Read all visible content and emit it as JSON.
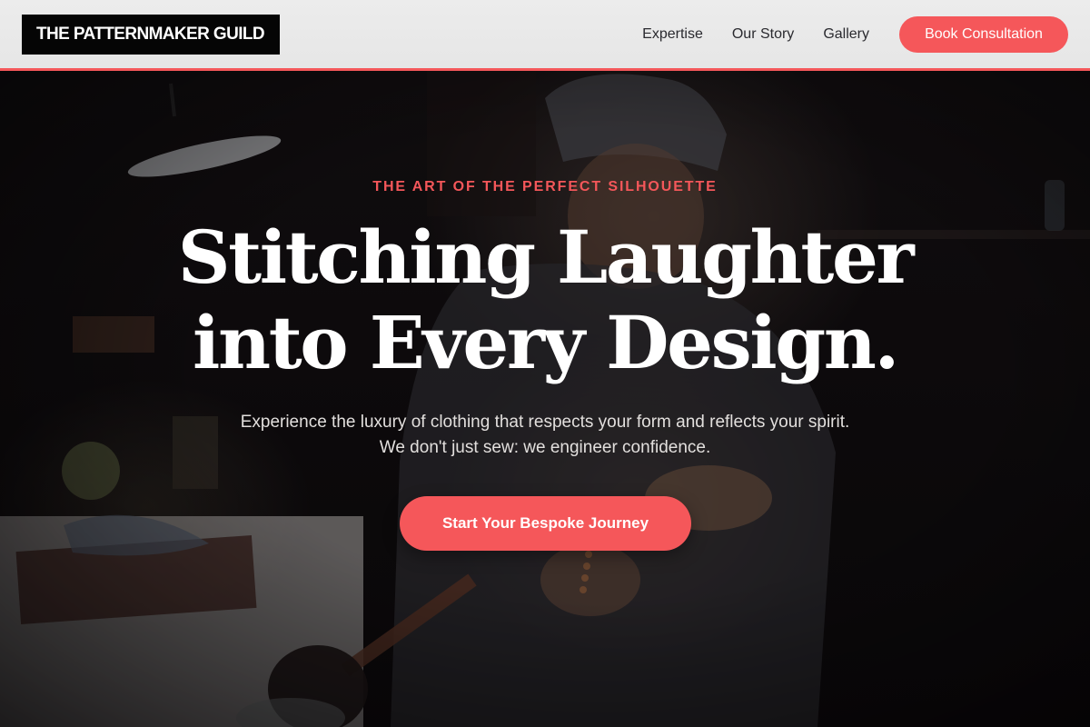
{
  "header": {
    "logo_text": "THE PATTERNMAKER GUILD",
    "nav": [
      {
        "label": "Expertise"
      },
      {
        "label": "Our Story"
      },
      {
        "label": "Gallery"
      }
    ],
    "cta_label": "Book Consultation"
  },
  "hero": {
    "eyebrow": "THE ART OF THE PERFECT SILHOUETTE",
    "headline_line1": "Stitching Laughter",
    "headline_line2": "into Every Design.",
    "lede": "Experience the luxury of clothing that respects your form and reflects your spirit. We don't just sew: we engineer confidence.",
    "cta_label": "Start Your Bespoke Journey"
  },
  "colors": {
    "accent": "#f5575a",
    "header_bg": "#e8e8e8",
    "logo_bg": "#050505",
    "hero_bg": "#0e0c0d",
    "headline": "#ffffff"
  }
}
